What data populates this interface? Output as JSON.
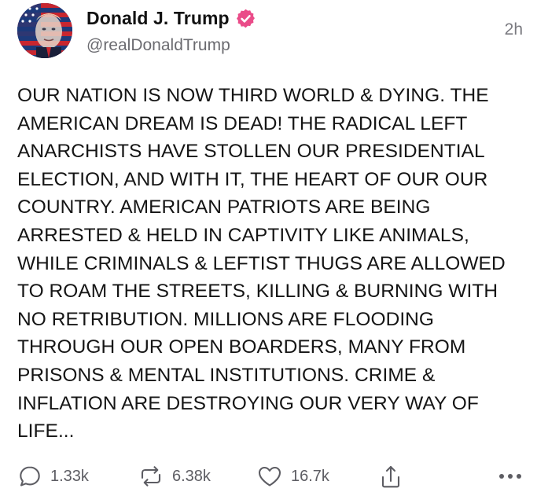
{
  "post": {
    "author": {
      "display_name": "Donald J. Trump",
      "handle": "@realDonaldTrump",
      "verified": true,
      "verified_color": "#ea4c89"
    },
    "timestamp": "2h",
    "body": "OUR NATION IS NOW THIRD WORLD & DYING. THE\nAMERICAN DREAM IS DEAD! THE RADICAL LEFT\nANARCHISTS HAVE STOLLEN OUR PRESIDENTIAL\nELECTION, AND WITH IT, THE HEART OF OUR OUR\nCOUNTRY. AMERICAN PATRIOTS ARE BEING\nARRESTED & HELD IN CAPTIVITY LIKE ANIMALS,\nWHILE CRIMINALS & LEFTIST THUGS ARE ALLOWED\nTO ROAM THE STREETS, KILLING & BURNING WITH\nNO RETRIBUTION. MILLIONS ARE FLOODING\nTHROUGH OUR OPEN BOARDERS, MANY FROM\nPRISONS & MENTAL INSTITUTIONS. CRIME &\nINFLATION ARE DESTROYING OUR VERY WAY OF\nLIFE...",
    "actions": {
      "replies": {
        "icon": "reply-icon",
        "count": "1.33k"
      },
      "retruths": {
        "icon": "retruth-icon",
        "count": "6.38k"
      },
      "likes": {
        "icon": "heart-icon",
        "count": "16.7k"
      },
      "share": {
        "icon": "share-icon"
      },
      "more": {
        "icon": "more-icon"
      }
    }
  }
}
